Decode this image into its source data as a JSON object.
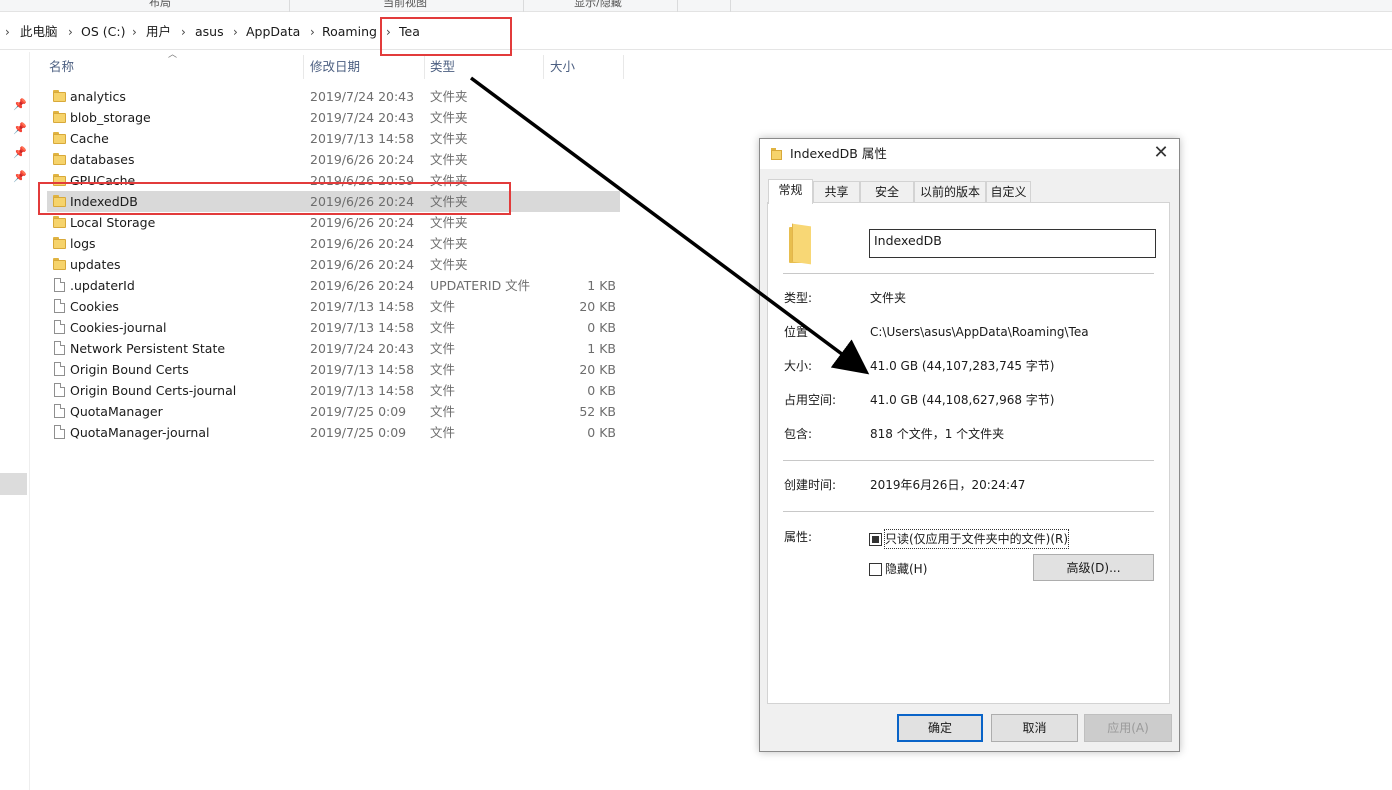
{
  "ribbon": {
    "groups": [
      "布局",
      "当前视图",
      "显示/隐藏"
    ]
  },
  "breadcrumb": {
    "items": [
      "此电脑",
      "OS (C:)",
      "用户",
      "asus",
      "AppData",
      "Roaming",
      "Tea"
    ]
  },
  "columns": {
    "name": "名称",
    "date": "修改日期",
    "type": "类型",
    "size": "大小"
  },
  "files": [
    {
      "name": "analytics",
      "date": "2019/7/24 20:43",
      "type": "文件夹",
      "size": "",
      "icon": "folder-icon"
    },
    {
      "name": "blob_storage",
      "date": "2019/7/24 20:43",
      "type": "文件夹",
      "size": "",
      "icon": "folder-icon"
    },
    {
      "name": "Cache",
      "date": "2019/7/13 14:58",
      "type": "文件夹",
      "size": "",
      "icon": "folder-icon"
    },
    {
      "name": "databases",
      "date": "2019/6/26 20:24",
      "type": "文件夹",
      "size": "",
      "icon": "folder-icon"
    },
    {
      "name": "GPUCache",
      "date": "2019/6/26 20:59",
      "type": "文件夹",
      "size": "",
      "icon": "folder-icon"
    },
    {
      "name": "IndexedDB",
      "date": "2019/6/26 20:24",
      "type": "文件夹",
      "size": "",
      "icon": "folder-icon",
      "selected": true
    },
    {
      "name": "Local Storage",
      "date": "2019/6/26 20:24",
      "type": "文件夹",
      "size": "",
      "icon": "folder-icon"
    },
    {
      "name": "logs",
      "date": "2019/6/26 20:24",
      "type": "文件夹",
      "size": "",
      "icon": "folder-icon"
    },
    {
      "name": "updates",
      "date": "2019/6/26 20:24",
      "type": "文件夹",
      "size": "",
      "icon": "folder-icon"
    },
    {
      "name": ".updaterId",
      "date": "2019/6/26 20:24",
      "type": "UPDATERID 文件",
      "size": "1 KB",
      "icon": "file-icon"
    },
    {
      "name": "Cookies",
      "date": "2019/7/13 14:58",
      "type": "文件",
      "size": "20 KB",
      "icon": "file-icon"
    },
    {
      "name": "Cookies-journal",
      "date": "2019/7/13 14:58",
      "type": "文件",
      "size": "0 KB",
      "icon": "file-icon"
    },
    {
      "name": "Network Persistent State",
      "date": "2019/7/24 20:43",
      "type": "文件",
      "size": "1 KB",
      "icon": "file-icon"
    },
    {
      "name": "Origin Bound Certs",
      "date": "2019/7/13 14:58",
      "type": "文件",
      "size": "20 KB",
      "icon": "file-icon"
    },
    {
      "name": "Origin Bound Certs-journal",
      "date": "2019/7/13 14:58",
      "type": "文件",
      "size": "0 KB",
      "icon": "file-icon"
    },
    {
      "name": "QuotaManager",
      "date": "2019/7/25 0:09",
      "type": "文件",
      "size": "52 KB",
      "icon": "file-icon"
    },
    {
      "name": "QuotaManager-journal",
      "date": "2019/7/25 0:09",
      "type": "文件",
      "size": "0 KB",
      "icon": "file-icon"
    }
  ],
  "dialog": {
    "title": "IndexedDB 属性",
    "close_glyph": "✕",
    "tabs": [
      "常规",
      "共享",
      "安全",
      "以前的版本",
      "自定义"
    ],
    "active_tab": "常规",
    "folder_name": "IndexedDB",
    "type_label": "类型:",
    "type_value": "文件夹",
    "location_label": "位置",
    "location_value": "C:\\Users\\asus\\AppData\\Roaming\\Tea",
    "size_label": "大小:",
    "size_value": "41.0 GB (44,107,283,745 字节)",
    "disk_label": "占用空间:",
    "disk_value": "41.0 GB (44,108,627,968 字节)",
    "contains_label": "包含:",
    "contains_value": "818 个文件，1 个文件夹",
    "created_label": "创建时间:",
    "created_value": "2019年6月26日，20:24:47",
    "attributes_label": "属性:",
    "readonly_label": "只读(仅应用于文件夹中的文件)(R)",
    "hidden_label": "隐藏(H)",
    "advanced_button": "高级(D)...",
    "ok_button": "确定",
    "cancel_button": "取消",
    "apply_button": "应用(A)"
  },
  "colors": {
    "highlight": "#e23b3b",
    "arrow": "#000000",
    "selection": "#d9d9d9",
    "primary_border": "#0a64c8"
  }
}
